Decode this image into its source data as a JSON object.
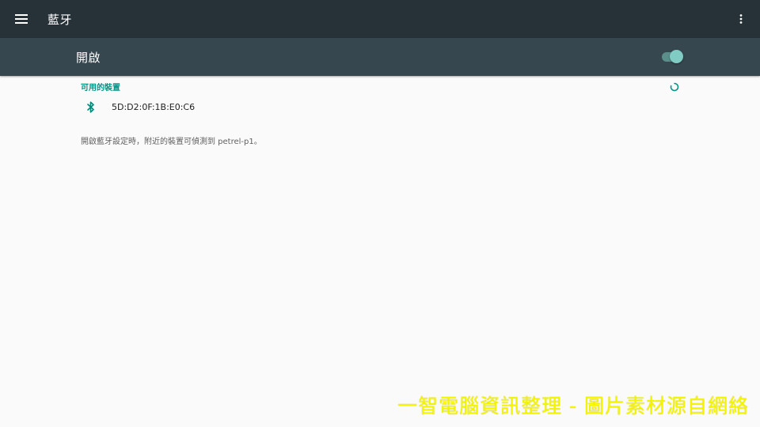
{
  "appbar": {
    "title": "藍牙",
    "menu_icon": "menu-icon",
    "overflow_icon": "more-vert-icon",
    "background": "#263238"
  },
  "switchbar": {
    "label": "開啟",
    "toggle_on": true,
    "background": "#37474f",
    "accent": "#80cbc4"
  },
  "available_devices": {
    "header": "可用的裝置",
    "scanning_icon": "progress-spinner-icon",
    "items": [
      {
        "icon": "bluetooth-icon",
        "name": "5D:D2:0F:1B:E0:C6"
      }
    ]
  },
  "footer_note": "開啟藍牙設定時，附近的裝置可偵測到 petrel-p1。",
  "watermark": "一智電腦資訊整理 - 圖片素材源自網絡",
  "colors": {
    "accent_teal": "#009688",
    "page_background": "#fafafa",
    "watermark": "#f5f500"
  }
}
